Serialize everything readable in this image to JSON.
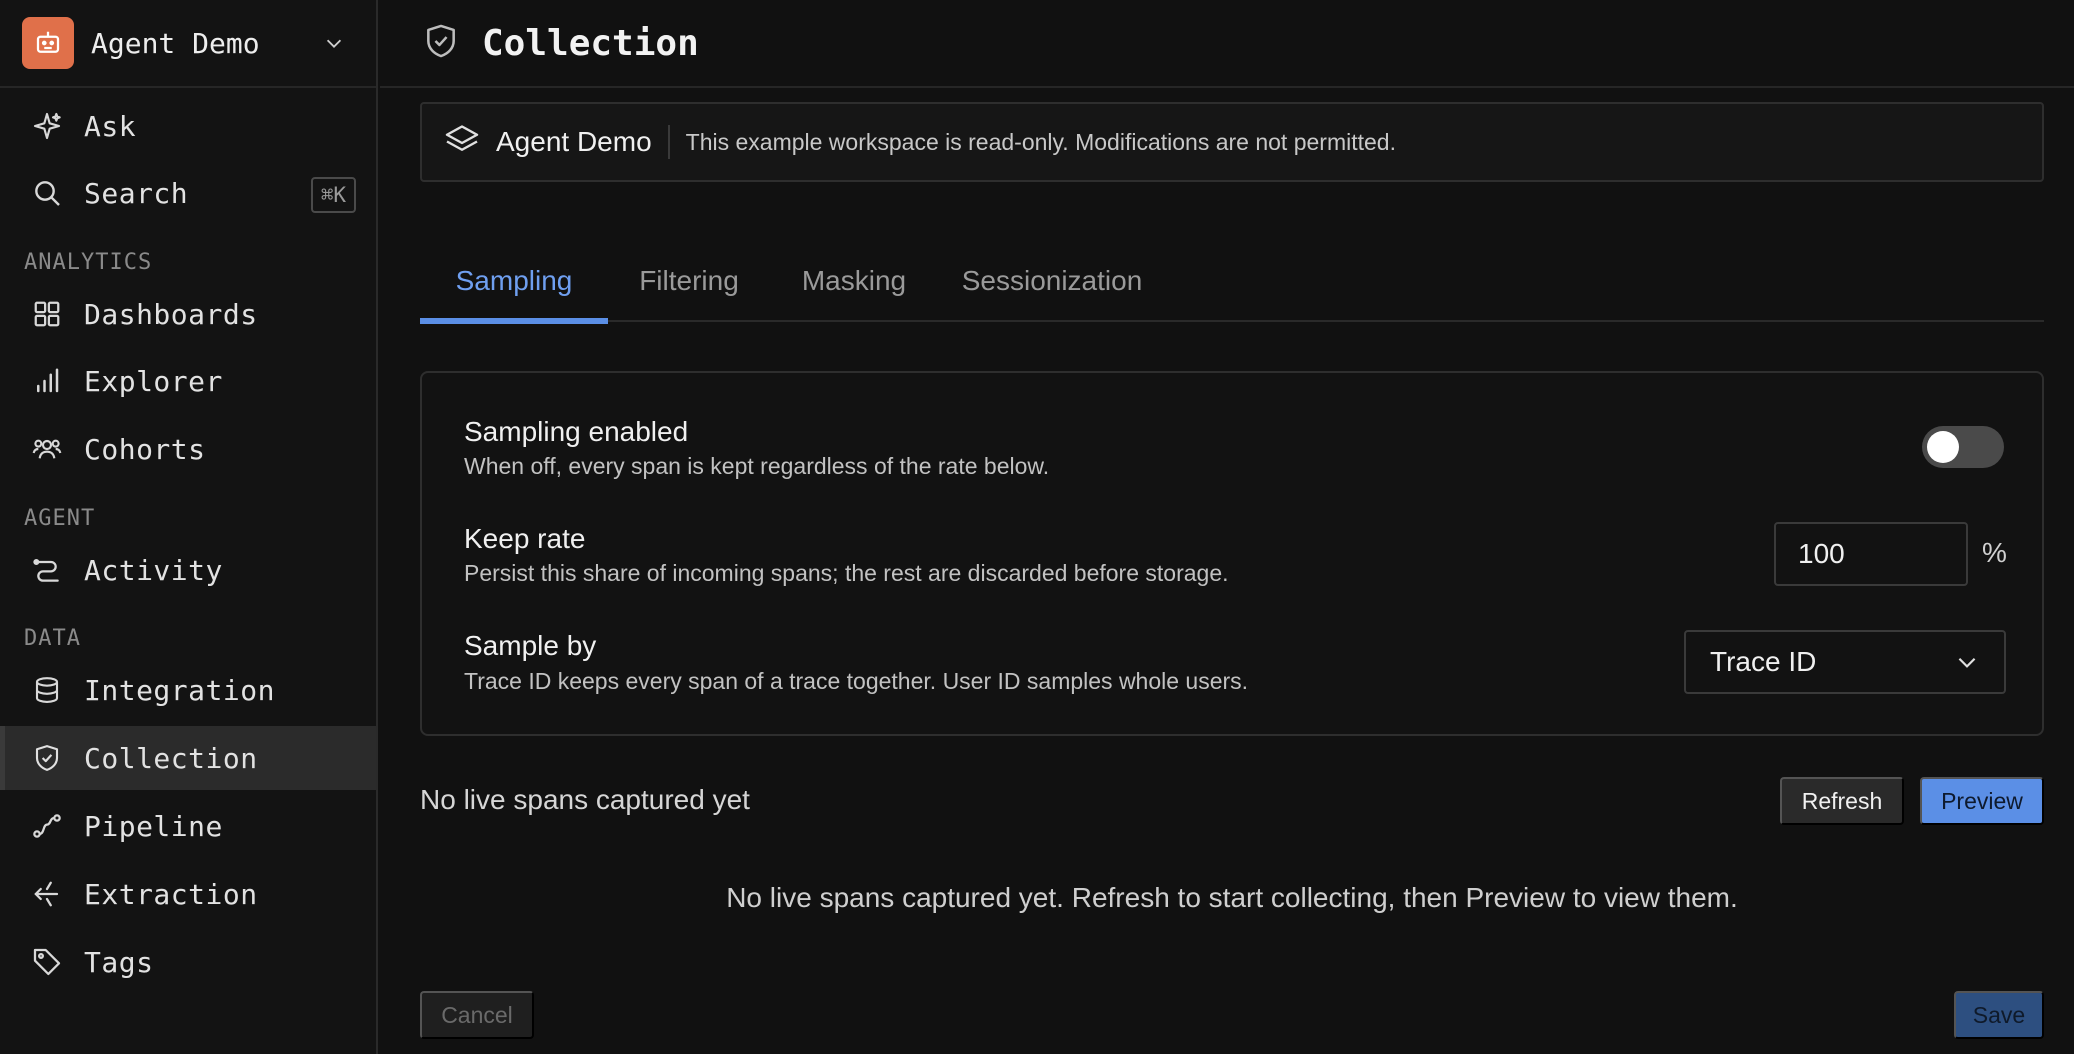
{
  "sidebar": {
    "workspace": {
      "name": "Agent Demo"
    },
    "top_items": [
      {
        "label": "Ask",
        "icon": "sparkle-icon"
      },
      {
        "label": "Search",
        "icon": "search-icon",
        "shortcut": "⌘K"
      }
    ],
    "sections": {
      "analytics": "ANALYTICS",
      "agent": "AGENT",
      "data": "DATA"
    },
    "analytics_items": [
      {
        "label": "Dashboards",
        "icon": "grid-icon"
      },
      {
        "label": "Explorer",
        "icon": "bar-chart-icon"
      },
      {
        "label": "Cohorts",
        "icon": "users-icon"
      }
    ],
    "agent_items": [
      {
        "label": "Activity",
        "icon": "route-icon"
      }
    ],
    "data_items": [
      {
        "label": "Integration",
        "icon": "database-icon"
      },
      {
        "label": "Collection",
        "icon": "shield-check-icon",
        "active": true
      },
      {
        "label": "Pipeline",
        "icon": "pipeline-icon"
      },
      {
        "label": "Extraction",
        "icon": "extract-icon"
      },
      {
        "label": "Tags",
        "icon": "tag-icon"
      }
    ]
  },
  "header": {
    "title": "Collection"
  },
  "banner": {
    "name": "Agent Demo",
    "message": "This example workspace is read-only. Modifications are not permitted."
  },
  "tabs": [
    {
      "label": "Sampling",
      "active": true
    },
    {
      "label": "Filtering"
    },
    {
      "label": "Masking"
    },
    {
      "label": "Sessionization"
    }
  ],
  "sampling": {
    "enabled": {
      "title": "Sampling enabled",
      "description": "When off, every span is kept regardless of the rate below.",
      "value": false
    },
    "keep_rate": {
      "title": "Keep rate",
      "description": "Persist this share of incoming spans; the rest are discarded before storage.",
      "value": "100",
      "unit": "%"
    },
    "sample_by": {
      "title": "Sample by",
      "description": "Trace ID keeps every span of a trace together. User ID samples whole users.",
      "value": "Trace ID"
    }
  },
  "live": {
    "title": "No live spans captured yet",
    "refresh_label": "Refresh",
    "preview_label": "Preview",
    "empty_message": "No live spans captured yet. Refresh to start collecting, then Preview to view them."
  },
  "footer": {
    "cancel_label": "Cancel",
    "save_label": "Save"
  },
  "colors": {
    "accent": "#5b8fe6",
    "logo": "#e0704a",
    "background": "#111111"
  }
}
